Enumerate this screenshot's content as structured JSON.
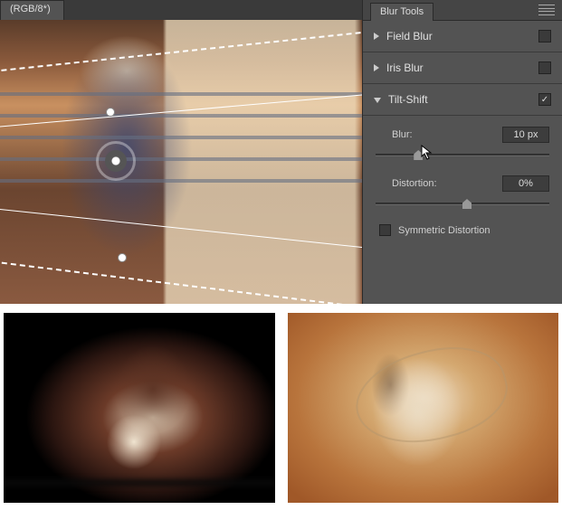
{
  "document": {
    "tab_label": "(RGB/8*)"
  },
  "panel": {
    "title": "Blur Tools",
    "sections": [
      {
        "name": "Field Blur",
        "expanded": false,
        "enabled": false
      },
      {
        "name": "Iris Blur",
        "expanded": false,
        "enabled": false
      },
      {
        "name": "Tilt-Shift",
        "expanded": true,
        "enabled": true
      }
    ],
    "tiltshift": {
      "blur_label": "Blur:",
      "blur_value": "10 px",
      "blur_slider_pct": 22,
      "distortion_label": "Distortion:",
      "distortion_value": "0%",
      "distortion_slider_pct": 50,
      "symmetric_label": "Symmetric Distortion",
      "symmetric_checked": false
    }
  }
}
